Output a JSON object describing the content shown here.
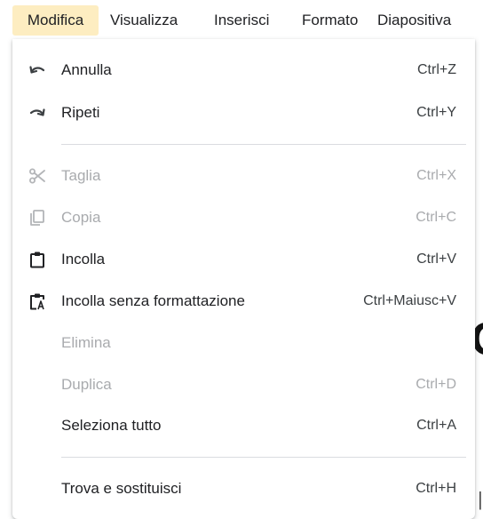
{
  "menubar": {
    "items": [
      {
        "label": "Modifica"
      },
      {
        "label": "Visualizza"
      },
      {
        "label": "Inserisci"
      },
      {
        "label": "Formato"
      },
      {
        "label": "Diapositiva"
      }
    ],
    "active_color": "#fdedc1"
  },
  "menu": {
    "items": [
      {
        "label": "Annulla",
        "shortcut": "Ctrl+Z",
        "icon": "undo-icon",
        "enabled": true
      },
      {
        "label": "Ripeti",
        "shortcut": "Ctrl+Y",
        "icon": "redo-icon",
        "enabled": true
      },
      {
        "label": "Taglia",
        "shortcut": "Ctrl+X",
        "icon": "scissors-icon",
        "enabled": false
      },
      {
        "label": "Copia",
        "shortcut": "Ctrl+C",
        "icon": "copy-icon",
        "enabled": false
      },
      {
        "label": "Incolla",
        "shortcut": "Ctrl+V",
        "icon": "clipboard-icon",
        "enabled": true
      },
      {
        "label": "Incolla senza formattazione",
        "shortcut": "Ctrl+Maiusc+V",
        "icon": "paste-plain-icon",
        "enabled": true
      },
      {
        "label": "Elimina",
        "shortcut": "",
        "enabled": false
      },
      {
        "label": "Duplica",
        "shortcut": "Ctrl+D",
        "enabled": false
      },
      {
        "label": "Seleziona tutto",
        "shortcut": "Ctrl+A",
        "enabled": true
      },
      {
        "label": "Trova e sostituisci",
        "shortcut": "Ctrl+H",
        "enabled": true
      }
    ],
    "enabled_color": "#202124",
    "disabled_color": "#a9abae"
  }
}
